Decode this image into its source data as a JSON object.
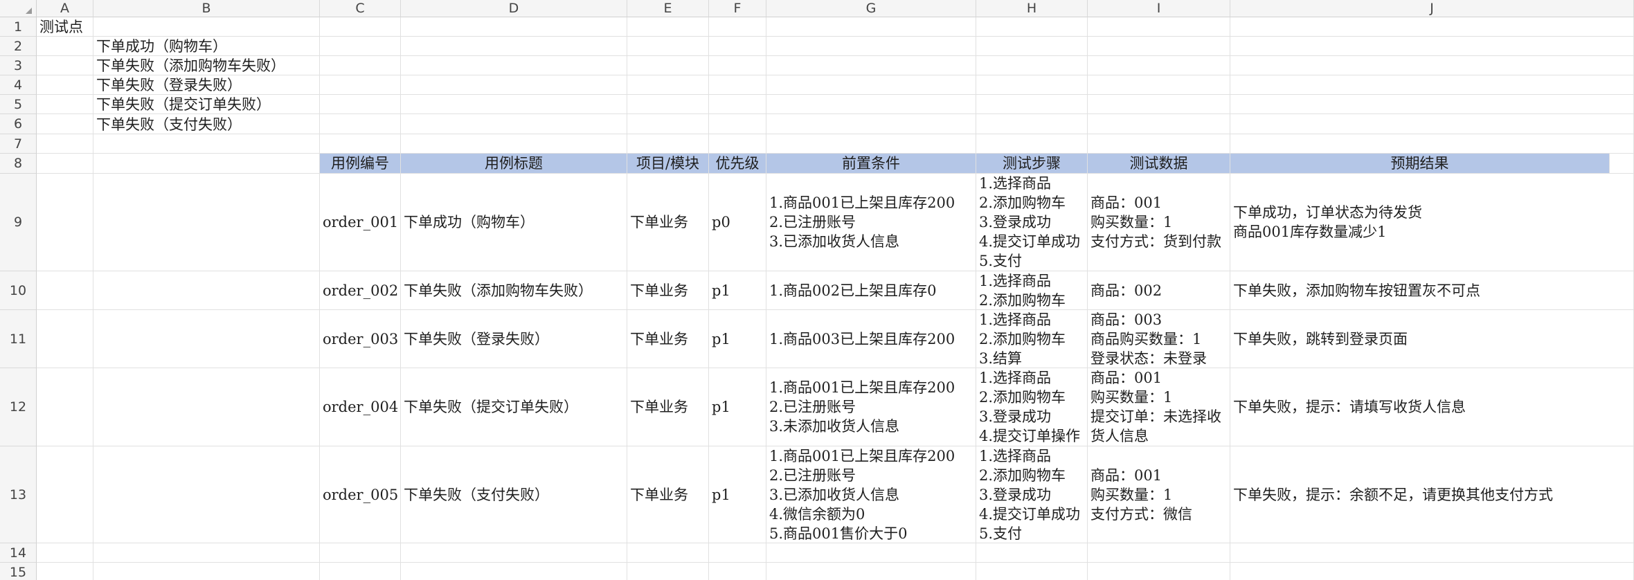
{
  "columns": [
    "A",
    "B",
    "C",
    "D",
    "E",
    "F",
    "G",
    "H",
    "I",
    "J"
  ],
  "rows": [
    "1",
    "2",
    "3",
    "4",
    "5",
    "6",
    "7",
    "8",
    "9",
    "10",
    "11",
    "12",
    "13",
    "14",
    "15"
  ],
  "test_points": {
    "title": "测试点",
    "items": [
      "下单成功（购物车）",
      "下单失败（添加购物车失败）",
      "下单失败（登录失败）",
      "下单失败（提交订单失败）",
      "下单失败（支付失败）"
    ]
  },
  "table": {
    "headers": [
      "用例编号",
      "用例标题",
      "项目/模块",
      "优先级",
      "前置条件",
      "测试步骤",
      "测试数据",
      "预期结果"
    ],
    "rows": [
      [
        "order_001",
        "下单成功（购物车）",
        "下单业务",
        "p0",
        "1.商品001已上架且库存200\n2.已注册账号\n3.已添加收货人信息",
        "1.选择商品\n2.添加购物车\n3.登录成功\n4.提交订单成功\n5.支付",
        "商品：001\n购买数量：1\n支付方式：货到付款",
        "下单成功，订单状态为待发货\n商品001库存数量减少1"
      ],
      [
        "order_002",
        "下单失败（添加购物车失败）",
        "下单业务",
        "p1",
        "1.商品002已上架且库存0",
        "1.选择商品\n2.添加购物车",
        "商品：002",
        "下单失败，添加购物车按钮置灰不可点"
      ],
      [
        "order_003",
        "下单失败（登录失败）",
        "下单业务",
        "p1",
        "1.商品003已上架且库存200",
        "1.选择商品\n2.添加购物车\n3.结算",
        "商品：003\n商品购买数量：1\n登录状态：未登录",
        "下单失败，跳转到登录页面"
      ],
      [
        "order_004",
        "下单失败（提交订单失败）",
        "下单业务",
        "p1",
        "1.商品001已上架且库存200\n2.已注册账号\n3.未添加收货人信息",
        "1.选择商品\n2.添加购物车\n3.登录成功\n4.提交订单操作",
        "商品：001\n购买数量：1\n提交订单：未选择收\n货人信息",
        "下单失败，提示：请填写收货人信息"
      ],
      [
        "order_005",
        "下单失败（支付失败）",
        "下单业务",
        "p1",
        "1.商品001已上架且库存200\n2.已注册账号\n3.已添加收货人信息\n4.微信余额为0\n5.商品001售价大于0",
        "1.选择商品\n2.添加购物车\n3.登录成功\n4.提交订单成功\n5.支付",
        "商品：001\n购买数量：1\n支付方式：微信",
        "下单失败，提示：余额不足，请更换其他支付方式"
      ]
    ]
  }
}
